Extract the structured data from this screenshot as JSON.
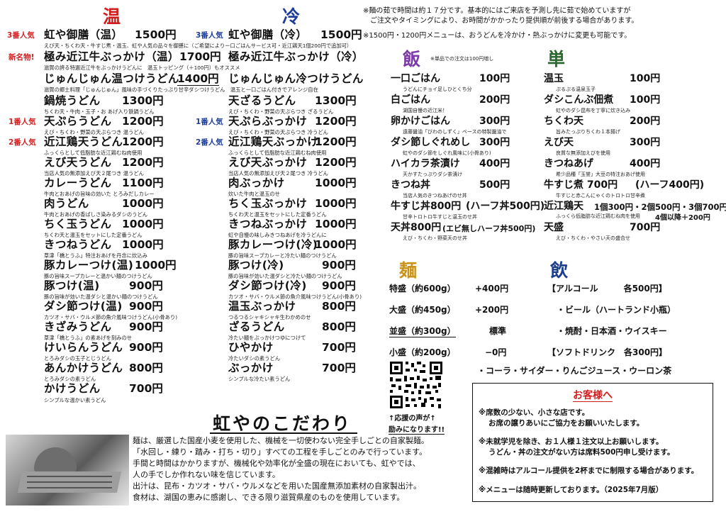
{
  "headers": {
    "hot": "温",
    "cold": "冷",
    "rice": "飯",
    "single": "単",
    "noodle": "麺",
    "drink": "飲"
  },
  "notes": {
    "line1": "※麺の茹で時間は約１７分です。基本的にはご来店を予測し先に茹で始めていますが",
    "line2": "ご注文やタイミングにより、お時間がかかったり提供順が前後する場合があります。",
    "line3": "※1500円・1200円メニューは、おうどんを冷かけ・熱ぶっかけに変更も可能です。"
  },
  "hot_badges": {
    "b1": "3番人気",
    "b2": "新名物!",
    "b3": "1番人気",
    "b4": "2番人気"
  },
  "cold_badges": {
    "b1": "3番人気",
    "b2": "1番人気",
    "b3": "2番人気"
  },
  "hot_items": [
    {
      "name": "虹や御膳（温）",
      "price": "1500円",
      "desc": "えび天・ちくわ天・牛すじ煮・温玉、虹や人気の品々を御膳に（ご希望によりー口ごはんサービス可・近江鶏天1個200円で追加可）"
    },
    {
      "name": "極み近江牛ぶっかけ（温）",
      "price": "1700円",
      "desc": "滋賀の誇る特選近江牛をぶっかけうどんに　温玉トッピング（＋100円）もオススメ"
    },
    {
      "name": "じゅんじゅん温つけうどん",
      "price": "1400円",
      "desc": "滋賀の郷土料理「じゅんじゅん」風味の手づくりたっぷり甘辛ダシつけうどん　温玉と一口ごはん付きでアレンジ自在"
    },
    {
      "name": "鍋焼うどん",
      "price": "1300円",
      "desc": "ちくわ天・牛肉・玉子・お あげ入り鉄鍋うどん"
    },
    {
      "name": "天ぷらうどん",
      "price": "1200円",
      "desc": "えび・ちくわ・野菜の天ぷらつき 温うどん"
    },
    {
      "name": "近江鶏天うどん",
      "price": "1200円",
      "desc": "ふっくらとして低脂肪な近江鶏むね肉使用"
    },
    {
      "name": "えび天うどん",
      "price": "1200円",
      "desc": "当店人気の無添加えび天２尾つき 温うどん"
    },
    {
      "name": "カレーうどん",
      "price": "1100円",
      "desc": "牛肉とおあげの旨味の効いた とろみだしカレー"
    },
    {
      "name": "肉うどん",
      "price": "1000円",
      "desc": "牛肉とおあげの香ばしさ染みるダシのうどん"
    },
    {
      "name": "ちく玉うどん",
      "price": "1000円",
      "desc": "ちくわ天と温玉をセットにした定番うどん"
    },
    {
      "name": "きつねうどん",
      "price": "1000円",
      "desc": "草津「橋とうふ」特注おあげを丹念に炊込み"
    },
    {
      "name": "豚カレーつけ(温)",
      "price": "1000円",
      "desc": "豚の旨味スープカレーと温かい麺のつけうどん"
    },
    {
      "name": "豚つけ(温)",
      "price": "900円",
      "desc": "豚の旨味が効いた温ダシと温かい麺のつけうどん"
    },
    {
      "name": "ダシ節つけ(温)",
      "price": "900円",
      "desc": "カツオ・サバ・ウルメ節の魚介風味つけうどん(小骨あり)"
    },
    {
      "name": "きざみうどん",
      "price": "900円",
      "desc": "草津「橋とうふ」の素あげを刻みのせ"
    },
    {
      "name": "けいらんうどん",
      "price": "900円",
      "desc": "とろみダシの玉子とじうどん"
    },
    {
      "name": "あんかけうどん",
      "price": "800円",
      "desc": "とろみダシの素うどん"
    },
    {
      "name": "かけうどん",
      "price": "700円",
      "desc": "シンプルな温かい素うどん"
    }
  ],
  "cold_items": [
    {
      "name": "虹や御膳（冷）",
      "price": "1500円",
      "desc": ""
    },
    {
      "name": "極み近江牛ぶっかけ（冷）",
      "price": "",
      "desc": ""
    },
    {
      "name": "じゅんじゅん冷つけうどん",
      "price": "",
      "desc": ""
    },
    {
      "name": "天ざるうどん",
      "price": "1300円",
      "desc": "えび・ちくわ・野菜の天ぷらつき ざるうどん"
    },
    {
      "name": "天ぷらぶっかけ",
      "price": "1200円",
      "desc": "えび・ちくわ・野菜の天ぷらつき 冷うどん"
    },
    {
      "name": "近江鶏天ぶっかけ",
      "price": "1200円",
      "desc": "ふっくらとして低脂肪な近江鶏むね肉使用"
    },
    {
      "name": "えび天ぶっかけ",
      "price": "1200円",
      "desc": "当店人気の無添加えび天２尾つき 冷うどん"
    },
    {
      "name": "肉ぶっかけ",
      "price": "1000円",
      "desc": "炊いた牛肉と温玉のせ"
    },
    {
      "name": "ちく玉ぶっかけ",
      "price": "1000円",
      "desc": "ちくわ天と温玉をセットにした定番うどん"
    },
    {
      "name": "きつねぶっかけ",
      "price": "1000円",
      "desc": "虹や自慢の味しみきつねあげを冷うどんに"
    },
    {
      "name": "豚カレーつけ(冷)",
      "price": "1000円",
      "desc": "豚の旨味スープカレーと冷たい麺のつけうどん"
    },
    {
      "name": "豚つけ(冷)",
      "price": "900円",
      "desc": "豚の旨味が効いた温ダシと冷たい麺のつけうどん"
    },
    {
      "name": "ダシ節つけ(冷)",
      "price": "900円",
      "desc": "カツオ・サバ・ウルメ節の魚介風味つけうどん(小骨あり)"
    },
    {
      "name": "温玉ぶっかけ",
      "price": "800円",
      "desc": "つるつるシャキシャキ生わかめのせ"
    },
    {
      "name": "ざるうどん",
      "price": "800円",
      "desc": "冷たい麺をぶっかけつゆにつけて"
    },
    {
      "name": "ひやかけ",
      "price": "700円",
      "desc": "冷たいダシの素うどん"
    },
    {
      "name": "ぶっかけ",
      "price": "700円",
      "desc": "シンプルな冷たい素うどん"
    }
  ],
  "rice_note": "※単品での注文は100円増し",
  "rice_items": [
    {
      "name": "一口ごはん",
      "price": "100円",
      "desc": "うどんにチョイ足しひとくち分"
    },
    {
      "name": "白ごはん",
      "price": "200円",
      "desc": "湖国自慢の近江米！"
    },
    {
      "name": "卵かけごはん",
      "price": "300円",
      "desc": "遠藤醤油「びわのしずく」ベースの特製醤油で"
    },
    {
      "name": "ダシ節しぐれめし",
      "price": "300円",
      "desc": "虹やのダシ節をしぐれ風味に(小骨あり)"
    },
    {
      "name": "ハイカラ茶漬け",
      "price": "400円",
      "desc": "天かすたっぷりダシ茶漬け"
    },
    {
      "name": "きつね丼",
      "price": "500円",
      "desc": "当店人気のきつねあげのせ丼"
    },
    {
      "name": "牛すじ丼800円",
      "price": "(ハーフ丼500円)",
      "desc": "甘辛トロトロ牛すじと温玉のせ丼"
    },
    {
      "name": "天丼800円",
      "price": "(エビ無しハーフ丼500円)",
      "desc": "えび・ちくわ・野菜天のせ丼"
    }
  ],
  "single_items": [
    {
      "name": "温玉",
      "price": "100円",
      "desc": "ぷるぷる温泉玉子"
    },
    {
      "name": "ダシこんぶ佃煮",
      "price": "100円",
      "desc": "虹やのダシ昆布を丁寧に炊き込み"
    },
    {
      "name": "ちくわ天",
      "price": "200円",
      "desc": "旨みたっぷりちくわ１本揚げ"
    },
    {
      "name": "えび天",
      "price": "300円",
      "desc": "良質な無添加えびを使用"
    },
    {
      "name": "きつねあげ",
      "price": "400円",
      "desc": "希少品種「玉誉」大豆の特注おあげ使用"
    },
    {
      "name": "牛すじ煮 700円",
      "price": "(ハーフ400円)",
      "desc": "牛すじと赤こんにゃくのトロトロ甘辛煮"
    },
    {
      "name": "近江鶏天",
      "price": "1個300円・2個500円・3個700円",
      "desc": "ふっくら低脂肪な近江鶏むね肉を使用"
    },
    {
      "name": "天盛",
      "price": "700円",
      "desc": "えび・ちくわ・やさい天の盛合せ"
    }
  ],
  "single_extra": "4個以降＋200円",
  "noodle_sizes": [
    {
      "label": "特盛（約600g）",
      "price": "+400円"
    },
    {
      "label": "大盛（約450g）",
      "price": "+200円"
    },
    {
      "label": "並盛（約300g）",
      "price": "標準"
    },
    {
      "label": "小盛（約200g）",
      "price": "−0円"
    }
  ],
  "drinks": {
    "alcohol": "【アルコール　　　各500円】",
    "beer": "・ビール（ハートランド小瓶）",
    "spirits": "・焼酎・日本酒・ウイスキー",
    "soft": "【ソフトドリンク　各300円】",
    "soft_list": "・コーラ・サイダー・りんごジュース・ウーロン茶"
  },
  "qr_caption1": "↑応援の声が↑",
  "qr_caption2": "励みになります!!",
  "kodawari": {
    "title": "虹やのこだわり",
    "l1": "麺は、厳選した国産小麦を使用した、機械を一切使わない完全手しごとの自家製麺。",
    "l2": "「水回し・練り・踏み・打ち・切り」すべての工程を手しごとのみで行っています。",
    "l3": "手間と時間はかかりますが、機械化や効率化が全盛の現在においても、虹やでは、",
    "l4": "人の手でしか作れない味を信じています。",
    "l5": "出汁は、昆布・カツオ・サバ・ウルメなどを用いた国産無添加素材の自家製出汁。",
    "l6": "食材は、湖国の恵みに感謝し、できる限り滋賀県産のものを使用しています。"
  },
  "customer_box": {
    "title": "お客様へ",
    "l1": "※席数の少ない、小さな店です。",
    "l2": "お席の譲りあいにご協力をお願いいたします。",
    "l3": "※未就学児を除き、お１人様１注文以上お願いします。",
    "l4": "うどん・丼の注文がない方は席料500円申し受けます。",
    "l5": "※混雑時はアルコール提供を2杯までに制限する場合があります。",
    "l6": "※メニューは随時更新しております。（2025年7月版）"
  }
}
